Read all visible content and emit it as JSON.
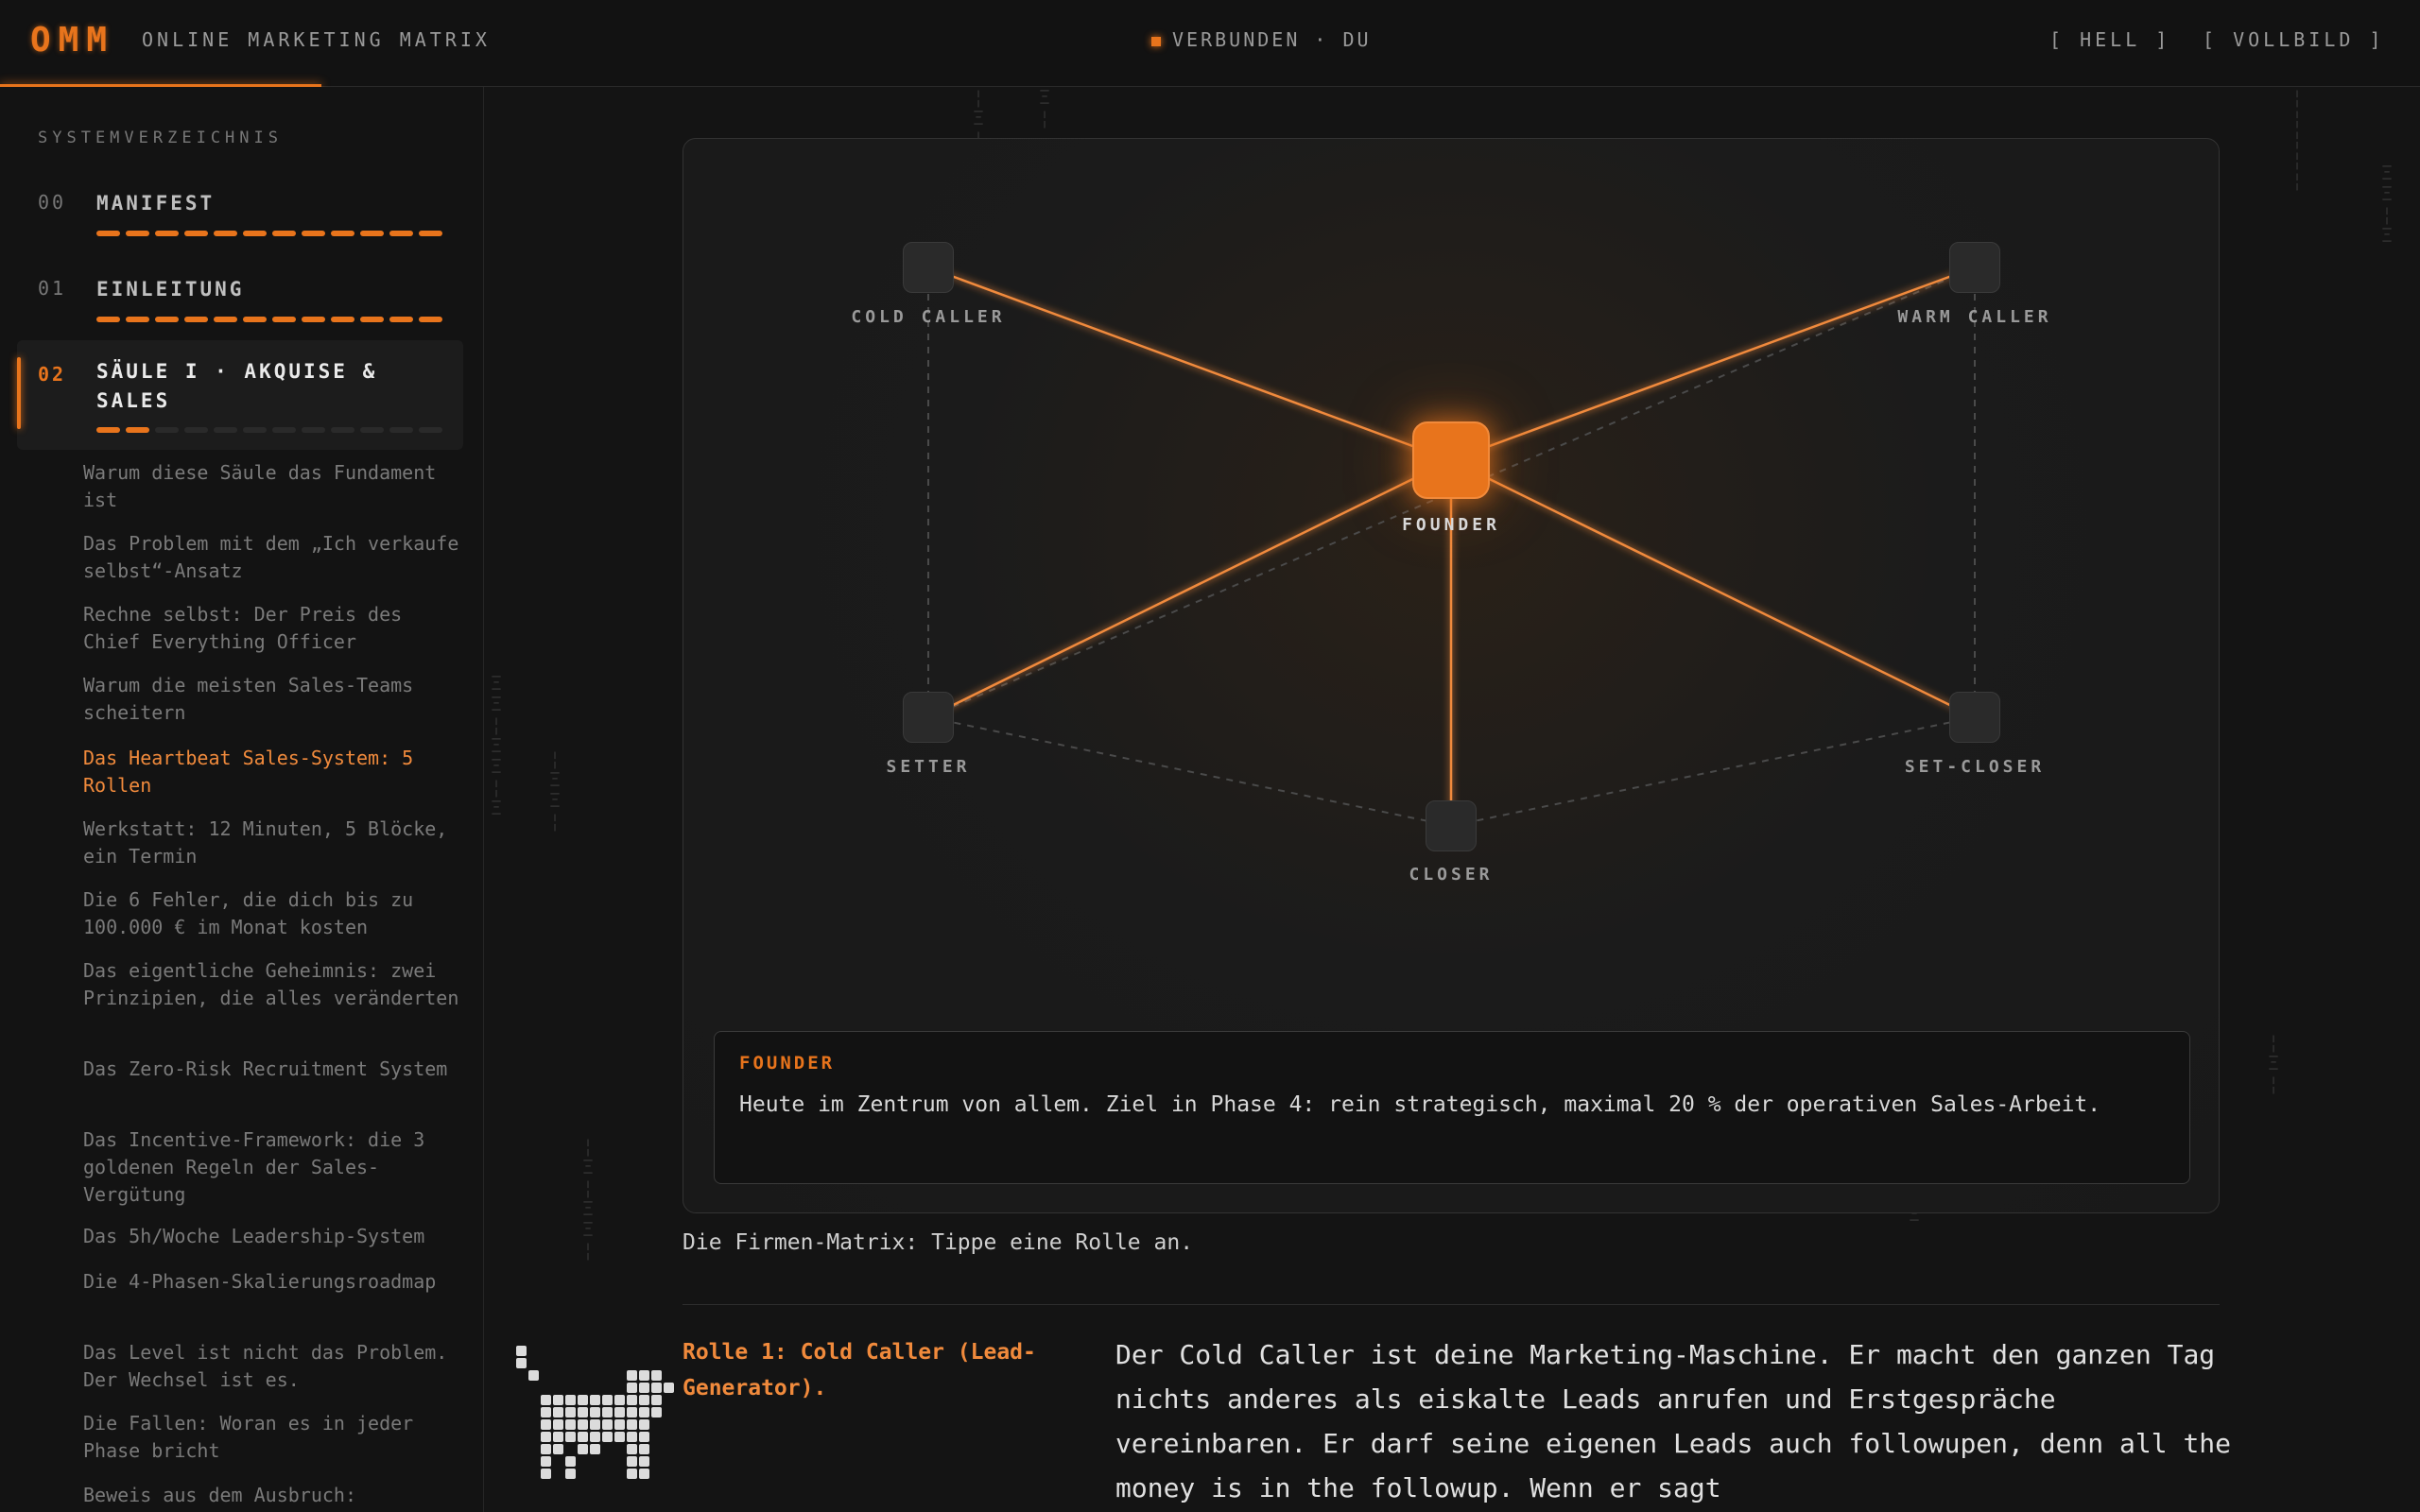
{
  "header": {
    "logo": "OMM",
    "brand": "ONLINE MARKETING MATRIX",
    "status": "VERBUNDEN · DU",
    "hell_label": "[ HELL ]",
    "vollbild_label": "[ VOLLBILD ]",
    "accent_color": "#e8741c"
  },
  "sidebar": {
    "title": "SYSTEMVERZEICHNIS",
    "chapters": [
      {
        "num": "00",
        "title": "MANIFEST",
        "progress_done": 12,
        "progress_total": 12
      },
      {
        "num": "01",
        "title": "EINLEITUNG",
        "progress_done": 12,
        "progress_total": 12
      },
      {
        "num": "02",
        "title": "SÄULE I · AKQUISE & SALES",
        "progress_done": 2,
        "progress_total": 12
      }
    ],
    "sections": [
      "Warum diese Säule das Fundament ist",
      "Das Problem mit dem „Ich verkaufe selbst“-Ansatz",
      "Rechne selbst: Der Preis des Chief Everything Officer",
      "Warum die meisten Sales-Teams scheitern",
      "Das Heartbeat Sales-System: 5 Rollen",
      "Werkstatt: 12 Minuten, 5 Blöcke, ein Termin",
      "Die 6 Fehler, die dich bis zu 100.000 € im Monat kosten",
      "Das eigentliche Geheimnis: zwei Prinzipien, die alles veränderten",
      "Das Zero-Risk Recruitment System",
      "Das Incentive-Framework: die 3 goldenen Regeln der Sales-Vergütung",
      "Das 5h/Woche Leadership-System",
      "Die 4-Phasen-Skalierungsroadmap",
      "Das Level ist nicht das Problem. Der Wechsel ist es.",
      "Die Fallen: Woran es in jeder Phase bricht",
      "Beweis aus dem Ausbruch:"
    ],
    "current_section_index": 4
  },
  "matrix": {
    "nodes": {
      "founder": "FOUNDER",
      "cold_caller": "COLD CALLER",
      "warm_caller": "WARM CALLER",
      "setter": "SETTER",
      "set_closer": "SET-CLOSER",
      "closer": "CLOSER"
    },
    "info_title": "FOUNDER",
    "info_text": "Heute im Zentrum von allem. Ziel in Phase 4: rein strategisch, maximal 20 % der operativen Sales-Arbeit."
  },
  "content": {
    "caption": "Die Firmen-Matrix: Tippe eine Rolle an.",
    "role_heading": "Rolle 1: Cold Caller (Lead-Generator).",
    "body": "Der Cold Caller ist deine Marketing-Maschine. Er macht den ganzen Tag nichts anderes als eiskalte Leads anrufen und Erstgespräche vereinbaren. Er darf seine eigenen Leads auch followupen, denn all the money is in the followup. Wenn er sagt"
  }
}
